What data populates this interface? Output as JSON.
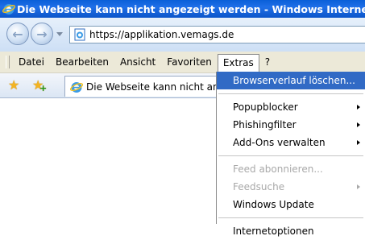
{
  "window": {
    "title": "Die Webseite kann nicht angezeigt werden - Windows Internet Explorer"
  },
  "address_bar": {
    "url": "https://applikation.vemags.de"
  },
  "menubar": {
    "items": [
      "Datei",
      "Bearbeiten",
      "Ansicht",
      "Favoriten",
      "Extras",
      "?"
    ],
    "active": "Extras"
  },
  "tab": {
    "title": "Die Webseite kann nicht angezeigt werden"
  },
  "extras_menu": {
    "items": [
      {
        "label": "Browserverlauf löschen...",
        "highlighted": true
      },
      {
        "separator": true
      },
      {
        "label": "Popupblocker",
        "submenu": true
      },
      {
        "label": "Phishingfilter",
        "submenu": true
      },
      {
        "label": "Add-Ons verwalten",
        "submenu": true
      },
      {
        "separator": true
      },
      {
        "label": "Feed abonnieren...",
        "disabled": true
      },
      {
        "label": "Feedsuche",
        "disabled": true,
        "submenu": true
      },
      {
        "label": "Windows Update"
      },
      {
        "separator": true
      },
      {
        "label": "Internetoptionen"
      }
    ]
  },
  "colors": {
    "title_bar": "#0a5fd8",
    "menu_highlight": "#316ac5",
    "disabled_text": "#a9a9a9"
  },
  "icons": [
    "ie-logo-icon",
    "back-icon",
    "forward-icon",
    "nav-dropdown-icon",
    "page-icon",
    "favorites-star-icon",
    "add-favorites-icon"
  ]
}
